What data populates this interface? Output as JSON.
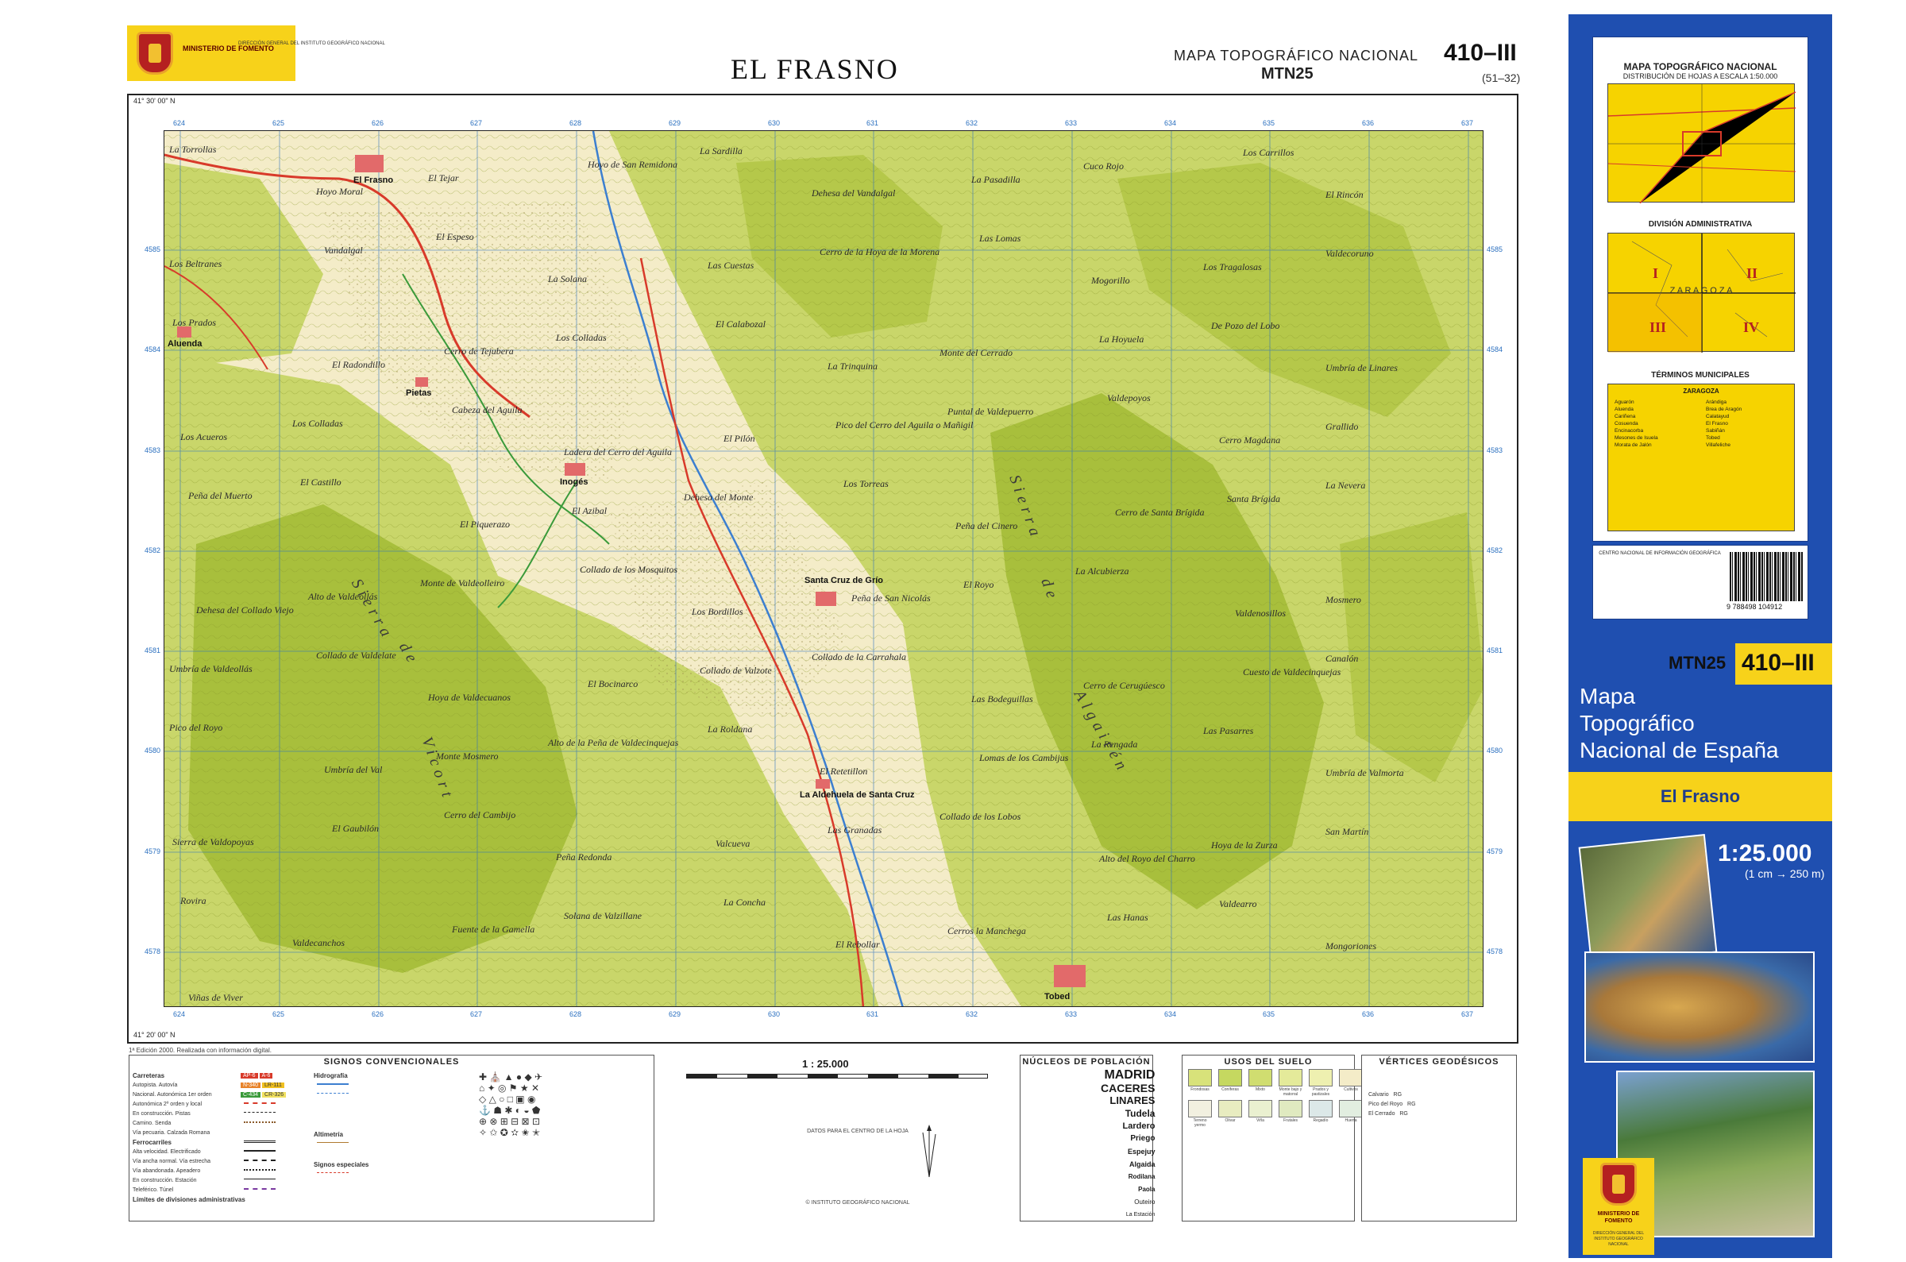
{
  "header": {
    "ministry": "MINISTERIO DE FOMENTO",
    "directorate": "DIRECCIÓN GENERAL DEL INSTITUTO GEOGRÁFICO NACIONAL",
    "sheet_name": "EL FRASNO",
    "series_name": "MAPA TOPOGRÁFICO NACIONAL",
    "series_code": "MTN25",
    "sheet_number": "410–III",
    "sheet_alt": "(51–32)"
  },
  "colors": {
    "lowland": "#f4ecc8",
    "vegetation": "#c9d66a",
    "mountains": "#a8bf3c",
    "river": "#3c7fd0",
    "road": "#d83a2a",
    "track": "#3a9a3a",
    "grid": "#2a6fbf",
    "cover_blue": "#1f4fb0",
    "cover_yellow": "#f7d21a"
  },
  "map": {
    "grid_x": [
      "624",
      "625",
      "626",
      "627",
      "628",
      "629",
      "630",
      "631",
      "632",
      "633",
      "634",
      "635",
      "636",
      "637"
    ],
    "grid_y": [
      "4585",
      "4584",
      "4583",
      "4582",
      "4581",
      "4580",
      "4579",
      "4578"
    ],
    "corner_nw": "41° 30' 00\" N",
    "corner_sw": "41° 20' 00\" N",
    "towns": [
      {
        "label": "El Frasno"
      },
      {
        "label": "Inogés"
      },
      {
        "label": "Santa Cruz de Grío"
      },
      {
        "label": "Tobed"
      },
      {
        "label": "Aluenda"
      },
      {
        "label": "Pietas"
      },
      {
        "label": "La Aldehuela de Santa Cruz"
      }
    ],
    "places": [
      {
        "label": "La Torrollas"
      },
      {
        "label": "Hoyo Moral"
      },
      {
        "label": "El Tejar"
      },
      {
        "label": "Hoyo de San Remidona"
      },
      {
        "label": "La Sardilla"
      },
      {
        "label": "Dehesa del Vandalgal"
      },
      {
        "label": "La Pasadilla"
      },
      {
        "label": "Cuco Rojo"
      },
      {
        "label": "Los Carrillos"
      },
      {
        "label": "El Rincón"
      },
      {
        "label": "Los Beltranes"
      },
      {
        "label": "Vandalgal"
      },
      {
        "label": "El Espeso"
      },
      {
        "label": "La Solana"
      },
      {
        "label": "Las Cuestas"
      },
      {
        "label": "Cerro de la Hoya de la Morena"
      },
      {
        "label": "Las Lomas"
      },
      {
        "label": "Mogorillo"
      },
      {
        "label": "Los Tragalosas"
      },
      {
        "label": "Valdecoruno"
      },
      {
        "label": "Los Prados"
      },
      {
        "label": "El Radondillo"
      },
      {
        "label": "Cerro de Tejubera"
      },
      {
        "label": "Los Colladas"
      },
      {
        "label": "El Calabozal"
      },
      {
        "label": "La Trinquina"
      },
      {
        "label": "Monte del Cerrado"
      },
      {
        "label": "La Hoyuela"
      },
      {
        "label": "De Pozo del Lobo"
      },
      {
        "label": "Umbría de Linares"
      },
      {
        "label": "Los Acueros"
      },
      {
        "label": "Los Colladas"
      },
      {
        "label": "Cabeza del Aguila"
      },
      {
        "label": "Ladera del Cerro del Aguila"
      },
      {
        "label": "El Pilón"
      },
      {
        "label": "Pico del Cerro del Aguila o Mañigil"
      },
      {
        "label": "Puntal de Valdepuerro"
      },
      {
        "label": "Valdepoyos"
      },
      {
        "label": "Cerro Magdana"
      },
      {
        "label": "Grallido"
      },
      {
        "label": "Peña del Muerto"
      },
      {
        "label": "El Castillo"
      },
      {
        "label": "El Piquerazo"
      },
      {
        "label": "El Azibal"
      },
      {
        "label": "Dehesa del Monte"
      },
      {
        "label": "Los Torreas"
      },
      {
        "label": "Peña del Cinero"
      },
      {
        "label": "Cerro de Santa Brígida"
      },
      {
        "label": "Santa Brígida"
      },
      {
        "label": "La Nevera"
      },
      {
        "label": "Dehesa del Collado Viejo"
      },
      {
        "label": "Alto de Valdeollás"
      },
      {
        "label": "Monte de Valdeolleiro"
      },
      {
        "label": "Collado de los Mosquitos"
      },
      {
        "label": "Los Bordillos"
      },
      {
        "label": "Peña de San Nicolás"
      },
      {
        "label": "El Royo"
      },
      {
        "label": "La Alcubierza"
      },
      {
        "label": "Valdenosillos"
      },
      {
        "label": "Mosmero"
      },
      {
        "label": "Umbría de Valdeollás"
      },
      {
        "label": "Collado de Valdelate"
      },
      {
        "label": "Hoya de Valdecuanos"
      },
      {
        "label": "El Bocinarco"
      },
      {
        "label": "Collado de Valzote"
      },
      {
        "label": "Collado de la Carrahala"
      },
      {
        "label": "Las Bodeguillas"
      },
      {
        "label": "Cerro de Cerugúesco"
      },
      {
        "label": "Cuesto de Valdecinquejas"
      },
      {
        "label": "Canalón"
      },
      {
        "label": "Pico del Royo"
      },
      {
        "label": "Umbría del Val"
      },
      {
        "label": "Monte Mosmero"
      },
      {
        "label": "Alto de la Peña de Valdecinquejas"
      },
      {
        "label": "La Roldana"
      },
      {
        "label": "El Retetillon"
      },
      {
        "label": "Lomas de los Cambijus"
      },
      {
        "label": "La Rengada"
      },
      {
        "label": "Las Pasarres"
      },
      {
        "label": "Umbría de Valmorta"
      },
      {
        "label": "Sierra de Valdopoyas"
      },
      {
        "label": "El Gaubilón"
      },
      {
        "label": "Cerro del Cambijo"
      },
      {
        "label": "Peña Redonda"
      },
      {
        "label": "Valcueva"
      },
      {
        "label": "Las Granadas"
      },
      {
        "label": "Collado de los Lobos"
      },
      {
        "label": "Alto del Royo del Charro"
      },
      {
        "label": "Hoya de la Zurza"
      },
      {
        "label": "San Martín"
      },
      {
        "label": "Rovira"
      },
      {
        "label": "Valdecanchos"
      },
      {
        "label": "Fuente de la Gamella"
      },
      {
        "label": "Solana de Valzillane"
      },
      {
        "label": "La Concha"
      },
      {
        "label": "El Rebollar"
      },
      {
        "label": "Cerros la Manchega"
      },
      {
        "label": "Las Hanas"
      },
      {
        "label": "Valdearro"
      },
      {
        "label": "Mongoriones"
      },
      {
        "label": "Viñas de Viver"
      }
    ],
    "sierra_labels": [
      {
        "label": "Sierra"
      },
      {
        "label": "de"
      },
      {
        "label": "Vicort"
      },
      {
        "label": "Sierra"
      },
      {
        "label": "de"
      },
      {
        "label": "Algairén"
      }
    ]
  },
  "edition_note": "1ª Edición 2000. Realizada con información digital.",
  "legend": {
    "signos_title": "SIGNOS CONVENCIONALES",
    "roads_header": "Carreteras",
    "road_items": [
      "Autopista. Autovía",
      "Nacional. Autonómica 1er orden",
      "Autonómica 2º orden y local",
      "En construcción. Pistas",
      "Camino. Senda",
      "Vía pecuaria. Calzada Romana"
    ],
    "rail_header": "Ferrocarriles",
    "rail_items": [
      "Alta velocidad. Electrificado",
      "Vía ancha normal. Vía estrecha",
      "Vía abandonada. Apeadero",
      "En construcción. Estación",
      "Teleférico. Túnel",
      "Límites de divisiones administrativas"
    ],
    "road_codes": [
      "AP-6",
      "A-6",
      "N-340",
      "LR-111",
      "C-434",
      "CR-326"
    ],
    "hydro_header": "Hidrografía",
    "alt_header": "Altimetría",
    "special_header": "Signos especiales",
    "scale": "1 : 25.000",
    "magnetic_header": "DATOS PARA EL CENTRO DE LA HOJA",
    "nucleos_title": "NÚCLEOS DE POBLACIÓN",
    "nucleos": [
      "MADRID",
      "CACERES",
      "LINARES",
      "Tudela",
      "Lardero",
      "Priego",
      "Espejuy",
      "Algaida",
      "Rodilana",
      "Paola",
      "Outeiro",
      "La Estación"
    ],
    "usos_title": "USOS DEL SUELO",
    "usos": [
      "Frondosas",
      "Coníferas",
      "Mixto",
      "Monte bajo y matorral",
      "Prados y pastizales",
      "Cultivos",
      "Terreno yermo",
      "Olivar",
      "Viña",
      "Frutales",
      "Regadío",
      "Huerta"
    ],
    "vertices_title": "VÉRTICES GEODÉSICOS",
    "vertices": [
      {
        "name": "Calvario",
        "orden": "RG"
      },
      {
        "name": "Pico del Royo",
        "orden": "RG"
      },
      {
        "name": "El Cerrado",
        "orden": "RG"
      }
    ],
    "copyright": "© INSTITUTO GEOGRÁFICO NACIONAL"
  },
  "cover": {
    "index_title": "MAPA TOPOGRÁFICO NACIONAL",
    "index_subtitle": "DISTRIBUCIÓN DE HOJAS A ESCALA 1:50.000",
    "admin_title": "DIVISIÓN ADMINISTRATIVA",
    "admin_province": "Z A R A G O Z A",
    "admin_quadrants": [
      "I",
      "II",
      "III",
      "IV"
    ],
    "municipal_title": "TÉRMINOS MUNICIPALES",
    "municipal_province": "ZARAGOZA",
    "municipios": [
      "Aguarón",
      "Aluenda",
      "Cariñena",
      "Cosuenda",
      "Encinacorba",
      "Mesones de Isuela",
      "Morata de Jalón",
      "Arándiga",
      "Brea de Aragón",
      "Calatayud",
      "El Frasno",
      "Sabiñán",
      "Tobed",
      "Villafeliche"
    ],
    "centro_text": "CENTRO NACIONAL DE INFORMACIÓN GEOGRÁFICA",
    "isbn": "9 788498 104912",
    "mtn_code": "MTN25",
    "sheet_number": "410–III",
    "title_line1": "Mapa",
    "title_line2": "Topográfico",
    "title_line3": "Nacional de España",
    "sheet_name": "El Frasno",
    "scale": "1:25.000",
    "scale_sub": "(1 cm → 250 m)",
    "logo_ministry": "MINISTERIO DE FOMENTO",
    "logo_directorate": "DIRECCIÓN GENERAL DEL INSTITUTO GEOGRÁFICO NACIONAL"
  }
}
